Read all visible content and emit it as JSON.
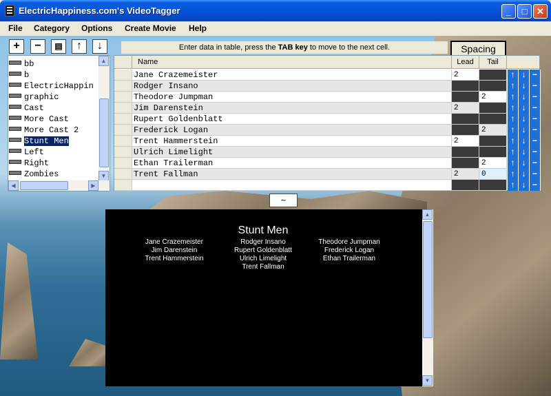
{
  "window": {
    "title": "ElectricHappiness.com's VideoTagger",
    "minimize": "_",
    "maximize": "□",
    "close": "✕"
  },
  "menu": [
    "File",
    "Category",
    "Options",
    "Create Movie",
    "Help"
  ],
  "toolbar": {
    "add": "+",
    "remove": "−",
    "page": "▤",
    "up": "↑",
    "down": "↓"
  },
  "hint": {
    "pre": "Enter data in table, press the ",
    "key": "TAB key",
    "post": " to move to the next cell."
  },
  "spacing_tab": "Spacing",
  "categories": {
    "items": [
      "bb",
      "b",
      "ElectricHappin",
      "graphic",
      "Cast",
      "More Cast",
      "More Cast 2",
      "Stunt Men",
      "Left",
      "Right",
      "Zombies"
    ],
    "selected": "Stunt Men"
  },
  "table": {
    "headers": {
      "name": "Name",
      "lead": "Lead",
      "tail": "Tail"
    },
    "rows": [
      {
        "name": "Jane Crazemeister",
        "lead": "2",
        "tail": ""
      },
      {
        "name": "Rodger Insano",
        "lead": "",
        "tail": ""
      },
      {
        "name": "Theodore Jumpman",
        "lead": "",
        "tail": "2"
      },
      {
        "name": "Jim Darenstein",
        "lead": "2",
        "tail": ""
      },
      {
        "name": "Rupert Goldenblatt",
        "lead": "",
        "tail": ""
      },
      {
        "name": "Frederick Logan",
        "lead": "",
        "tail": "2"
      },
      {
        "name": "Trent Hammerstein",
        "lead": "2",
        "tail": ""
      },
      {
        "name": "Ulrich Limelight",
        "lead": "",
        "tail": ""
      },
      {
        "name": "Ethan Trailerman",
        "lead": "",
        "tail": "2"
      },
      {
        "name": "Trent Fallman",
        "lead": "2",
        "tail": "0"
      },
      {
        "name": "",
        "lead": "",
        "tail": ""
      }
    ],
    "actions": {
      "up": "↑",
      "down": "↓",
      "delete": "−"
    }
  },
  "tilde_button": "~",
  "preview": {
    "title": "Stunt Men",
    "columns": [
      [
        "Jane Crazemeister",
        "Jim Darenstein",
        "Trent Hammerstein"
      ],
      [
        "Rodger Insano",
        "Rupert Goldenblatt",
        "Ulrich Limelight",
        "Trent Fallman"
      ],
      [
        "Theodore Jumpman",
        "Frederick Logan",
        "Ethan Trailerman"
      ]
    ]
  },
  "colors": {
    "accent": "#1e6fd6",
    "selection": "#0a246a",
    "titlebar": "#0453d6"
  }
}
